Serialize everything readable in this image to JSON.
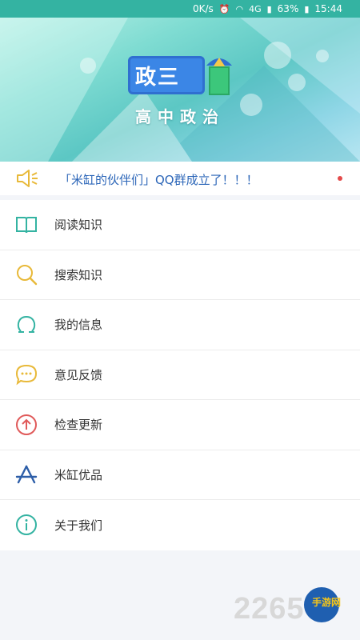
{
  "status_bar": {
    "speed": "0K/s",
    "network": "4G",
    "battery": "63%",
    "time": "15:44"
  },
  "banner": {
    "logo_text": "政三",
    "subtitle": "高中政治"
  },
  "notice": {
    "text": "「米缸的伙伴们」QQ群成立了！！！"
  },
  "menu": {
    "items": [
      {
        "label": "阅读知识",
        "icon": "book-icon"
      },
      {
        "label": "搜索知识",
        "icon": "search-icon"
      },
      {
        "label": "我的信息",
        "icon": "person-icon"
      },
      {
        "label": "意见反馈",
        "icon": "chat-bubble-icon"
      },
      {
        "label": "检查更新",
        "icon": "upload-arrow-icon"
      },
      {
        "label": "米缸优品",
        "icon": "app-store-icon"
      },
      {
        "label": "关于我们",
        "icon": "info-icon"
      }
    ]
  },
  "watermark": {
    "text": "2265",
    "brand": "手游网"
  },
  "colors": {
    "teal": "#34b3a2",
    "yellow": "#e8b939",
    "red": "#e05a5a",
    "blue": "#2d5ea8",
    "notice_text": "#2c66b8"
  }
}
